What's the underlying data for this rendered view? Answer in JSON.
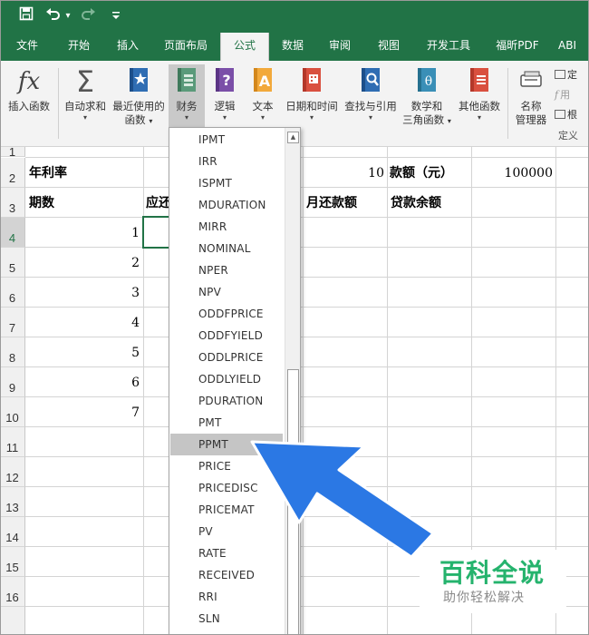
{
  "quick_access": {
    "save_icon": "save-icon",
    "undo_icon": "undo-icon",
    "undo_caret": "▾",
    "redo_icon": "redo-icon",
    "customize_icon": "customize-icon"
  },
  "tabs": [
    "文件",
    "开始",
    "插入",
    "页面布局",
    "公式",
    "数据",
    "审阅",
    "视图",
    "开发工具",
    "福昕PDF",
    "ABI"
  ],
  "active_tab": "公式",
  "ribbon": {
    "insert_function": "插入函数",
    "autosum": "自动求和",
    "recent_line1": "最近使用的",
    "recent_line2": "函数",
    "financial": "财务",
    "logical": "逻辑",
    "text": "文本",
    "datetime": "日期和时间",
    "lookup": "查找与引用",
    "math_line1": "数学和",
    "math_line2": "三角函数",
    "more": "其他函数",
    "name_mgr_line1": "名称",
    "name_mgr_line2": "管理器",
    "define_name": "定",
    "use_in_formula": "用",
    "create_from_sel": "根",
    "group_label": "定义",
    "caret": "▾"
  },
  "sheet": {
    "rows": [
      "1",
      "2",
      "3",
      "4",
      "5",
      "6",
      "7",
      "8",
      "9",
      "10",
      "11",
      "12",
      "13",
      "14",
      "15",
      "16"
    ],
    "a2": "年利率",
    "e2": "10",
    "f2": "款额（元）",
    "g2": "100000",
    "a3": "期数",
    "b3": "应还",
    "e3": "月还款额",
    "f3": "贷款余额",
    "periods": [
      "1",
      "2",
      "3",
      "4",
      "5",
      "6",
      "7"
    ]
  },
  "dropdown": {
    "items": [
      "IPMT",
      "IRR",
      "ISPMT",
      "MDURATION",
      "MIRR",
      "NOMINAL",
      "NPER",
      "NPV",
      "ODDFPRICE",
      "ODDFYIELD",
      "ODDLPRICE",
      "ODDLYIELD",
      "PDURATION",
      "PMT",
      "PPMT",
      "PRICE",
      "PRICEDISC",
      "PRICEMAT",
      "PV",
      "RATE",
      "RECEIVED",
      "RRI",
      "SLN"
    ],
    "highlighted": "PPMT",
    "scroll_up": "▲"
  },
  "watermark": {
    "title": "百科全说",
    "subtitle": "助你轻松解决"
  },
  "colors": {
    "excel_green": "#217346",
    "watermark_green": "#25b36d",
    "arrow_blue": "#2b78e4"
  }
}
